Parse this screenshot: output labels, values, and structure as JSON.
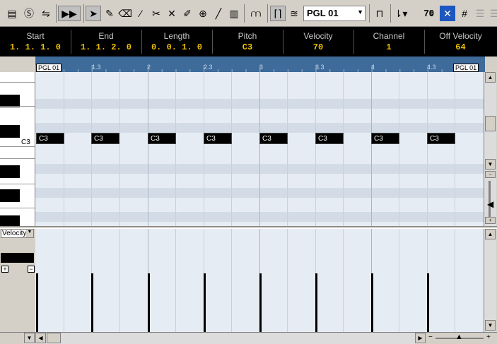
{
  "toolbar": {
    "preset": "PGL 01",
    "insert_velocity": "70",
    "icons": [
      "solo-editor-icon",
      "show-info-icon",
      "autoscroll-icon",
      "object-selection-icon",
      "draw-icon",
      "erase-icon",
      "trim-icon",
      "split-icon",
      "glue-icon",
      "mute-icon",
      "zoom-icon",
      "line-icon",
      "time-warp-icon",
      "quantize-icon",
      "legato-icon",
      "step-input-icon",
      "snap-icon",
      "grid-icon"
    ]
  },
  "infoline": {
    "fields": [
      {
        "label": "Start",
        "value": "1. 1. 1.   0"
      },
      {
        "label": "End",
        "value": "1. 1. 2.   0"
      },
      {
        "label": "Length",
        "value": "0. 0. 1.   0"
      },
      {
        "label": "Pitch",
        "value": "C3"
      },
      {
        "label": "Velocity",
        "value": "70"
      },
      {
        "label": "Channel",
        "value": "1"
      },
      {
        "label": "Off Velocity",
        "value": "64"
      }
    ]
  },
  "ruler": {
    "marks": [
      "1.3",
      "2",
      "2.3",
      "3",
      "3.3",
      "4",
      "4.3"
    ],
    "left_locator": "PGL 01",
    "right_locator": "PGL 01"
  },
  "keyboard": {
    "c3_label": "C3"
  },
  "notes": [
    {
      "pitch": "C3",
      "position": 0
    },
    {
      "pitch": "C3",
      "position": 1
    },
    {
      "pitch": "C3",
      "position": 2
    },
    {
      "pitch": "C3",
      "position": 3
    },
    {
      "pitch": "C3",
      "position": 4
    },
    {
      "pitch": "C3",
      "position": 5
    },
    {
      "pitch": "C3",
      "position": 6
    },
    {
      "pitch": "C3",
      "position": 7
    }
  ],
  "controller": {
    "lane_name": "Velocity",
    "velocities": [
      70,
      70,
      70,
      70,
      70,
      70,
      70,
      70
    ],
    "velocity_max": 127
  },
  "colors": {
    "info_text": "#f0c000",
    "ruler_bg": "#3e6b9a",
    "grid_bg": "#e6ecf4"
  }
}
